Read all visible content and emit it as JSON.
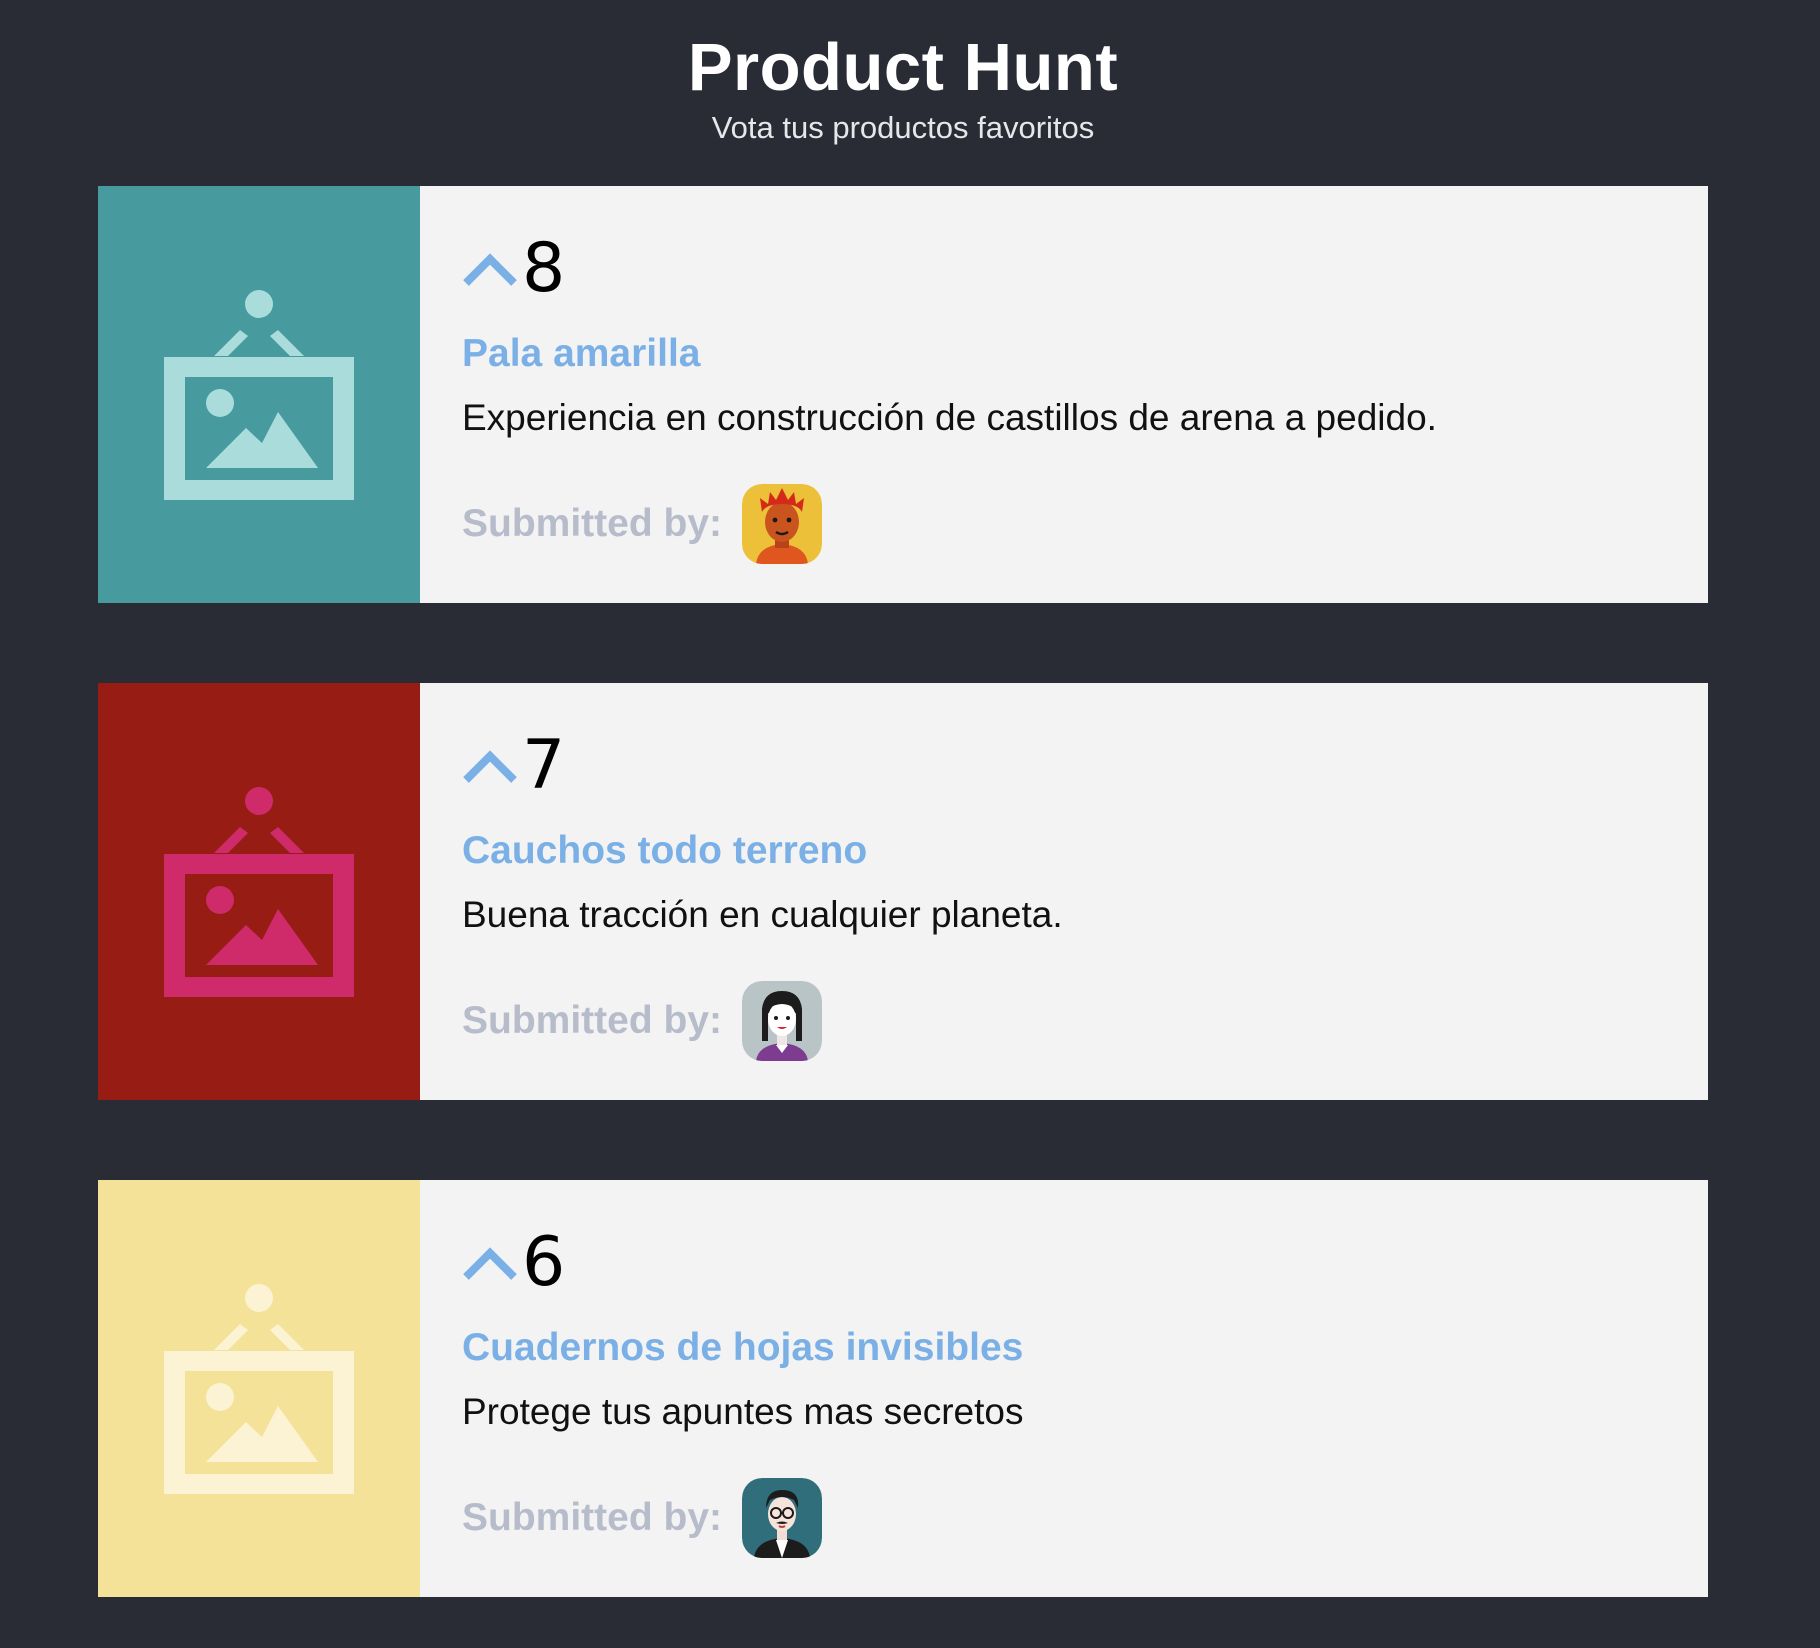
{
  "header": {
    "title": "Product Hunt",
    "subtitle": "Vota tus productos favoritos"
  },
  "products": [
    {
      "votes": "8",
      "title": "Pala amarilla",
      "description": "Experiencia en construcción de castillos de arena a pedido.",
      "submitted_label": "Submitted by:",
      "thumb_bg": "#479b9e",
      "thumb_fg": "#abdcdc",
      "avatar_icon": "avatar-redhair-icon"
    },
    {
      "votes": "7",
      "title": "Cauchos todo terreno",
      "description": "Buena tracción en cualquier planeta.",
      "submitted_label": "Submitted by:",
      "thumb_bg": "#961c14",
      "thumb_fg": "#cf2b6a",
      "avatar_icon": "avatar-woman-icon"
    },
    {
      "votes": "6",
      "title": "Cuadernos de hojas invisibles",
      "description": "Protege tus apuntes mas secretos",
      "submitted_label": "Submitted by:",
      "thumb_bg": "#f3e297",
      "thumb_fg": "#fcf3d5",
      "avatar_icon": "avatar-man-glasses-icon"
    }
  ],
  "colors": {
    "page_bg": "#292c35",
    "card_bg": "#f3f3f3",
    "accent": "#7ab0e6",
    "muted": "#b7bccb"
  }
}
